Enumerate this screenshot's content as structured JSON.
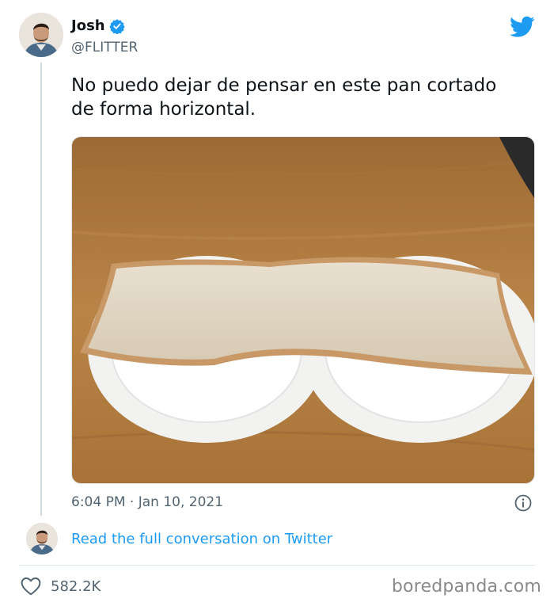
{
  "tweet": {
    "author_name": "Josh",
    "handle": "@FLITTER",
    "text": "No puedo dejar de pensar en este pan cortado\nde forma horizontal.",
    "timestamp": "6:04 PM · Jan 10, 2021",
    "conversation_link": "Read the full conversation on Twitter",
    "like_count": "582.2K"
  },
  "branding": {
    "watermark": "boredpanda.com"
  },
  "colors": {
    "twitter_blue": "#1d9bf0",
    "secondary_text": "#536471"
  },
  "icons": {
    "verified": "verified-badge-icon",
    "brand": "twitter-bird-icon",
    "info": "info-icon",
    "like": "heart-icon"
  }
}
